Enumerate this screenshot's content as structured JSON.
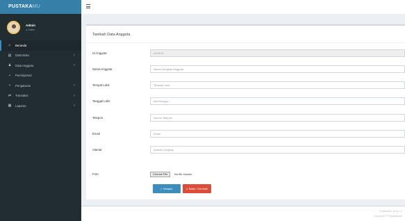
{
  "app": {
    "logo_main": "PUSTAKA",
    "logo_suffix": "MU"
  },
  "user": {
    "name": "Admin",
    "status": "● Online"
  },
  "sidebar": {
    "items": [
      {
        "label": "Beranda",
        "icon": "home-icon",
        "glyph": "⌂",
        "active": true,
        "has_children": false
      },
      {
        "label": "Data Buku",
        "icon": "book-icon",
        "glyph": "▤",
        "active": false,
        "has_children": true
      },
      {
        "label": "Data Anggota",
        "icon": "users-icon",
        "glyph": "♟",
        "active": false,
        "has_children": true
      },
      {
        "label": "Peminjaman",
        "icon": "cart-icon",
        "glyph": "▪",
        "active": false,
        "has_children": false
      },
      {
        "label": "Pengaturan",
        "icon": "gear-icon",
        "glyph": "▪",
        "active": false,
        "has_children": true
      },
      {
        "label": "Transaksi",
        "icon": "transfer-icon",
        "glyph": "⇄",
        "active": false,
        "has_children": true
      },
      {
        "label": "Laporan",
        "icon": "report-icon",
        "glyph": "▦",
        "active": false,
        "has_children": true
      }
    ]
  },
  "form": {
    "title": "Tambah Data Anggota",
    "fields": [
      {
        "label": "Id Anggota",
        "value": "AG0070",
        "placeholder": "",
        "disabled": true
      },
      {
        "label": "Nama Anggota",
        "value": "",
        "placeholder": "Nama Lengkap Anggota",
        "disabled": false
      },
      {
        "label": "Tempat Lahir",
        "value": "",
        "placeholder": "Tempat Lahir",
        "disabled": false
      },
      {
        "label": "Tanggal Lahir",
        "value": "",
        "placeholder": "dd/mm/yyyy",
        "disabled": false
      },
      {
        "label": "Telepon",
        "value": "",
        "placeholder": "Nomor Telepon",
        "disabled": false
      },
      {
        "label": "Email",
        "value": "",
        "placeholder": "Email",
        "disabled": false
      },
      {
        "label": "Alamat",
        "value": "",
        "placeholder": "Alamat Lengkap",
        "disabled": false
      }
    ],
    "photo_label": "Foto",
    "file_button": "Choose File",
    "file_status": "No file chosen",
    "save_label": "Simpan",
    "cancel_label": "Batal / Kembali"
  },
  "footer": {
    "line1": "PustakaMU Versi 1.0",
    "line2": "Copyright © Perpustakaan"
  },
  "colors": {
    "sidebar": "#222d32",
    "logo": "#367fa9",
    "primary": "#3c8dbc",
    "danger": "#dd4b39"
  }
}
